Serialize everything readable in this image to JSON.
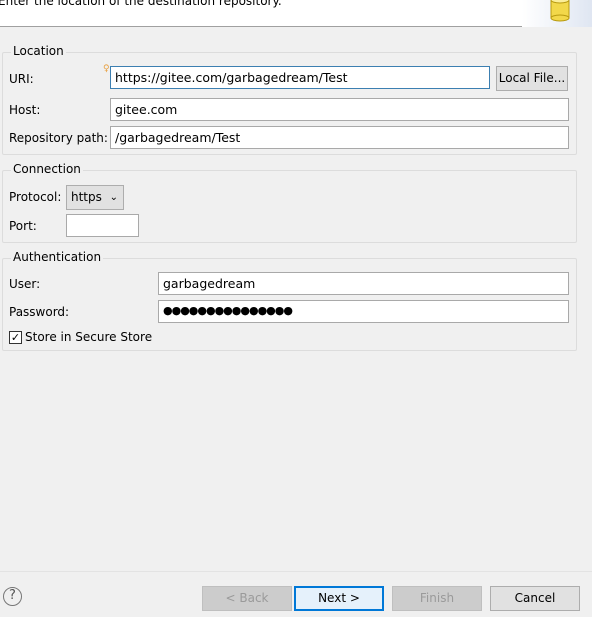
{
  "header": {
    "description": "Enter the location of the destination repository.",
    "icon": "database-icon"
  },
  "location": {
    "title": "Location",
    "uri_label": "URI:",
    "uri_value": "https://gitee.com/garbagedream/Test",
    "local_file_button": "Local File...",
    "host_label": "Host:",
    "host_value": "gitee.com",
    "path_label": "Repository path:",
    "path_value": "/garbagedream/Test"
  },
  "connection": {
    "title": "Connection",
    "protocol_label": "Protocol:",
    "protocol_value": "https",
    "port_label": "Port:",
    "port_value": ""
  },
  "authentication": {
    "title": "Authentication",
    "user_label": "User:",
    "user_value": "garbagedream",
    "password_label": "Password:",
    "password_value": "●●●●●●●●●●●●●●●",
    "store_label": "Store in Secure Store",
    "store_checked": true
  },
  "footer": {
    "back": "< Back",
    "next": "Next >",
    "finish": "Finish",
    "cancel": "Cancel",
    "help_icon": "help-icon"
  }
}
